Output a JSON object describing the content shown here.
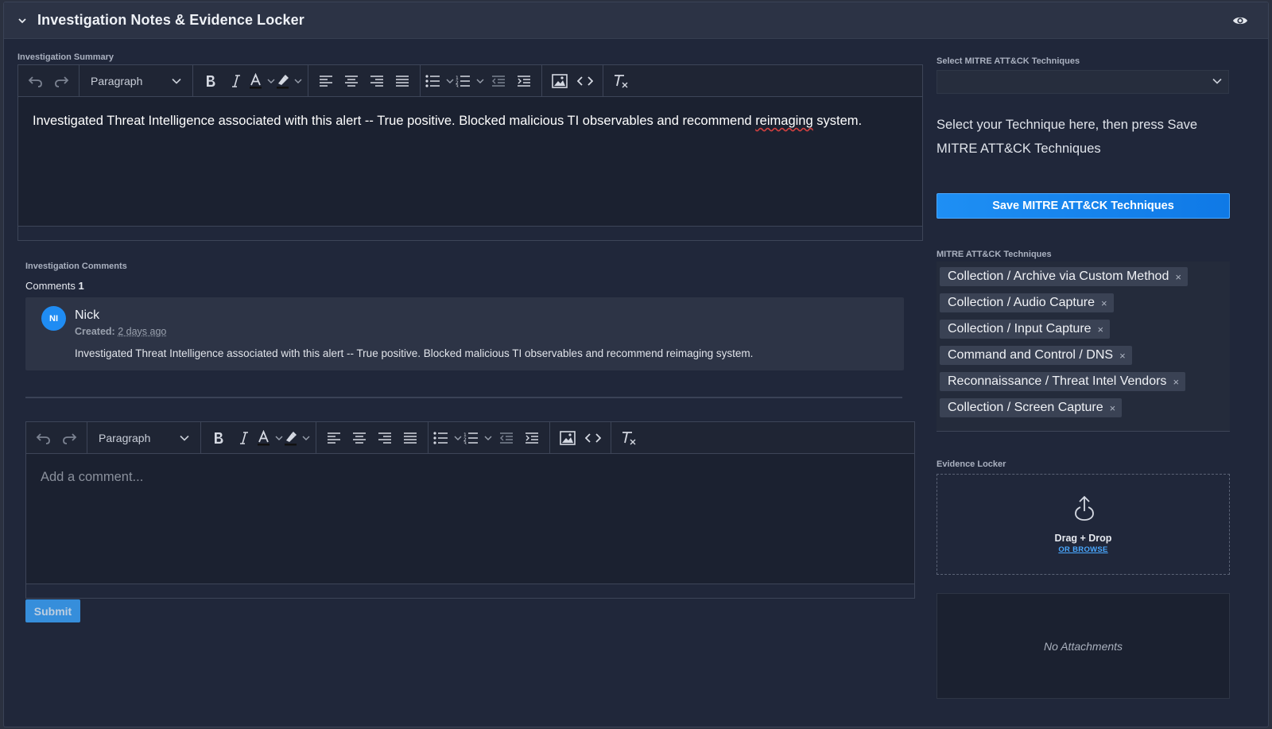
{
  "header": {
    "title": "Investigation Notes & Evidence Locker",
    "eye_icon": "eye-icon",
    "collapse_icon": "chevron-down-icon"
  },
  "summary": {
    "label": "Investigation Summary",
    "block_format": "Paragraph",
    "text_before": "Investigated Threat Intelligence associated with this alert -- True positive.  Blocked malicious TI observables and recommend ",
    "text_misspelled": "reimaging",
    "text_after": " system."
  },
  "comments": {
    "label": "Investigation Comments",
    "count_label": "Comments",
    "count": "1",
    "items": [
      {
        "initials": "NI",
        "author": "Nick",
        "created_label": "Created:",
        "created_ago": "2 days ago",
        "text": "Investigated Threat Intelligence associated with this alert -- True positive.  Blocked malicious TI observables and recommend reimaging system."
      }
    ],
    "editor": {
      "block_format": "Paragraph",
      "placeholder": "Add a comment..."
    },
    "submit_label": "Submit"
  },
  "mitre": {
    "select_label": "Select MITRE ATT&CK Techniques",
    "select_value": "",
    "help_text": "Select your Technique here, then press Save MITRE ATT&CK Techniques",
    "save_label": "Save MITRE ATT&CK Techniques",
    "list_label": "MITRE ATT&CK Techniques",
    "tags": [
      "Collection / Archive via Custom Method",
      "Collection / Audio Capture",
      "Collection / Input Capture",
      "Command and Control / DNS",
      "Reconnaissance / Threat Intel Vendors",
      "Collection / Screen Capture"
    ],
    "remove_glyph": "×"
  },
  "evidence": {
    "label": "Evidence Locker",
    "drop_text": "Drag + Drop",
    "browse_text": "OR BROWSE",
    "empty_text": "No Attachments"
  },
  "colors": {
    "accent": "#1e8ff4",
    "background": "#20273a",
    "header": "#2c3345"
  }
}
